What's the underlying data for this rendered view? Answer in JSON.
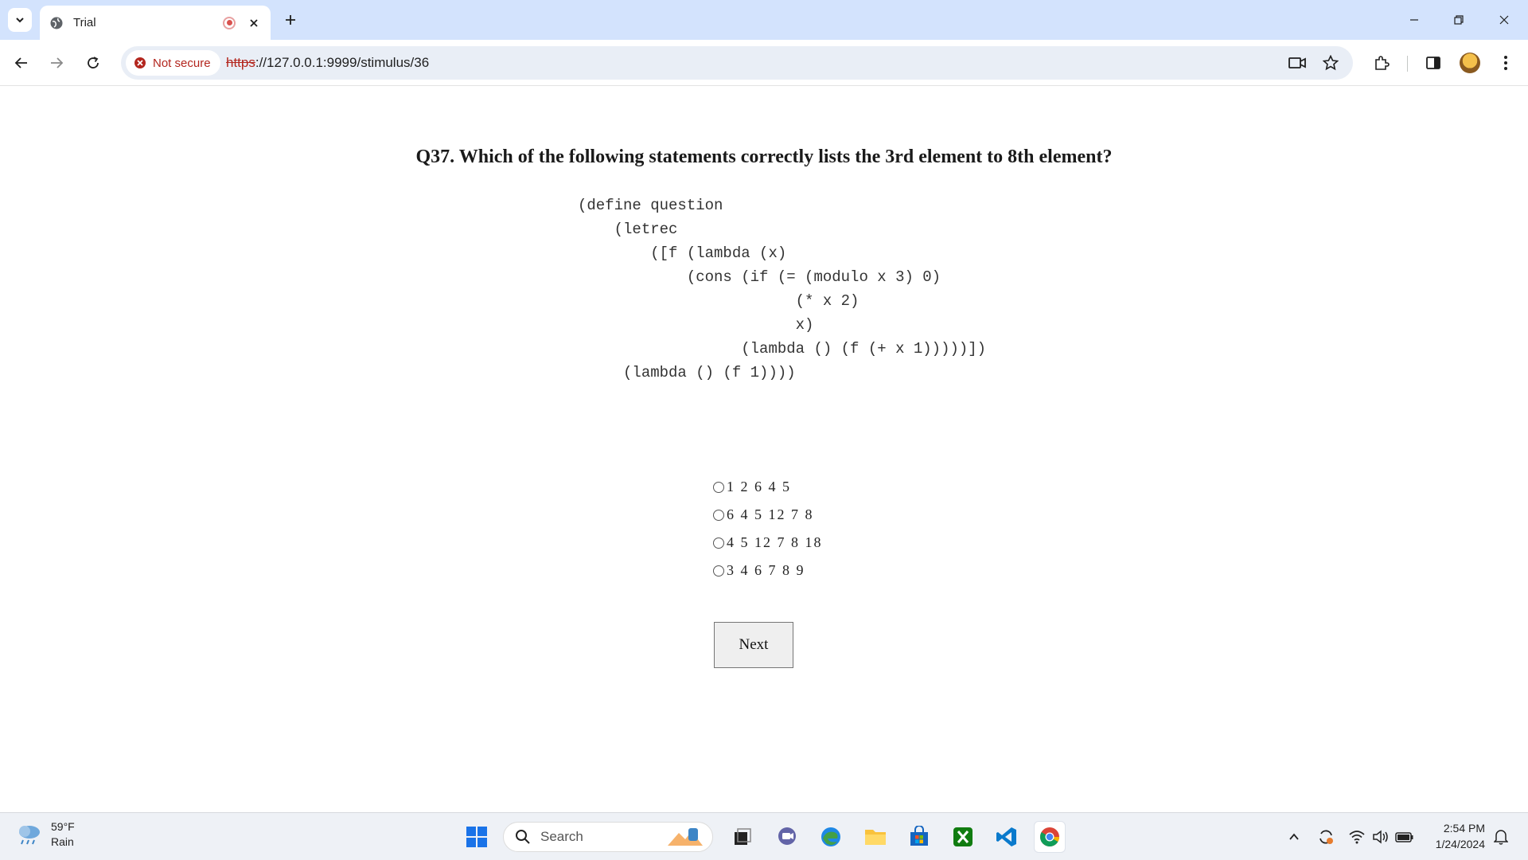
{
  "browser": {
    "tab_title": "Trial",
    "security_label": "Not secure",
    "url_scheme": "https",
    "url_rest": "://127.0.0.1:9999/stimulus/36"
  },
  "question": {
    "title": "Q37. Which of the following statements correctly lists the 3rd element to 8th element?",
    "code_lines": [
      "(define question",
      "    (letrec",
      "        ([f (lambda (x)",
      "            (cons (if (= (modulo x 3) 0)",
      "                        (* x 2)",
      "                        x)",
      "                  (lambda () (f (+ x 1)))))])",
      "     (lambda () (f 1))))"
    ],
    "options": [
      "1 2 6 4 5",
      "6 4 5 12 7 8",
      "4 5 12 7 8 18",
      "3 4 6 7 8 9"
    ],
    "next_label": "Next"
  },
  "taskbar": {
    "weather_temp": "59°F",
    "weather_cond": "Rain",
    "search_placeholder": "Search",
    "time": "2:54 PM",
    "date": "1/24/2024"
  },
  "colors": {
    "tabstrip_bg": "#d3e3fd",
    "omnibox_bg": "#e9eef6",
    "not_secure_red": "#b3261e"
  }
}
